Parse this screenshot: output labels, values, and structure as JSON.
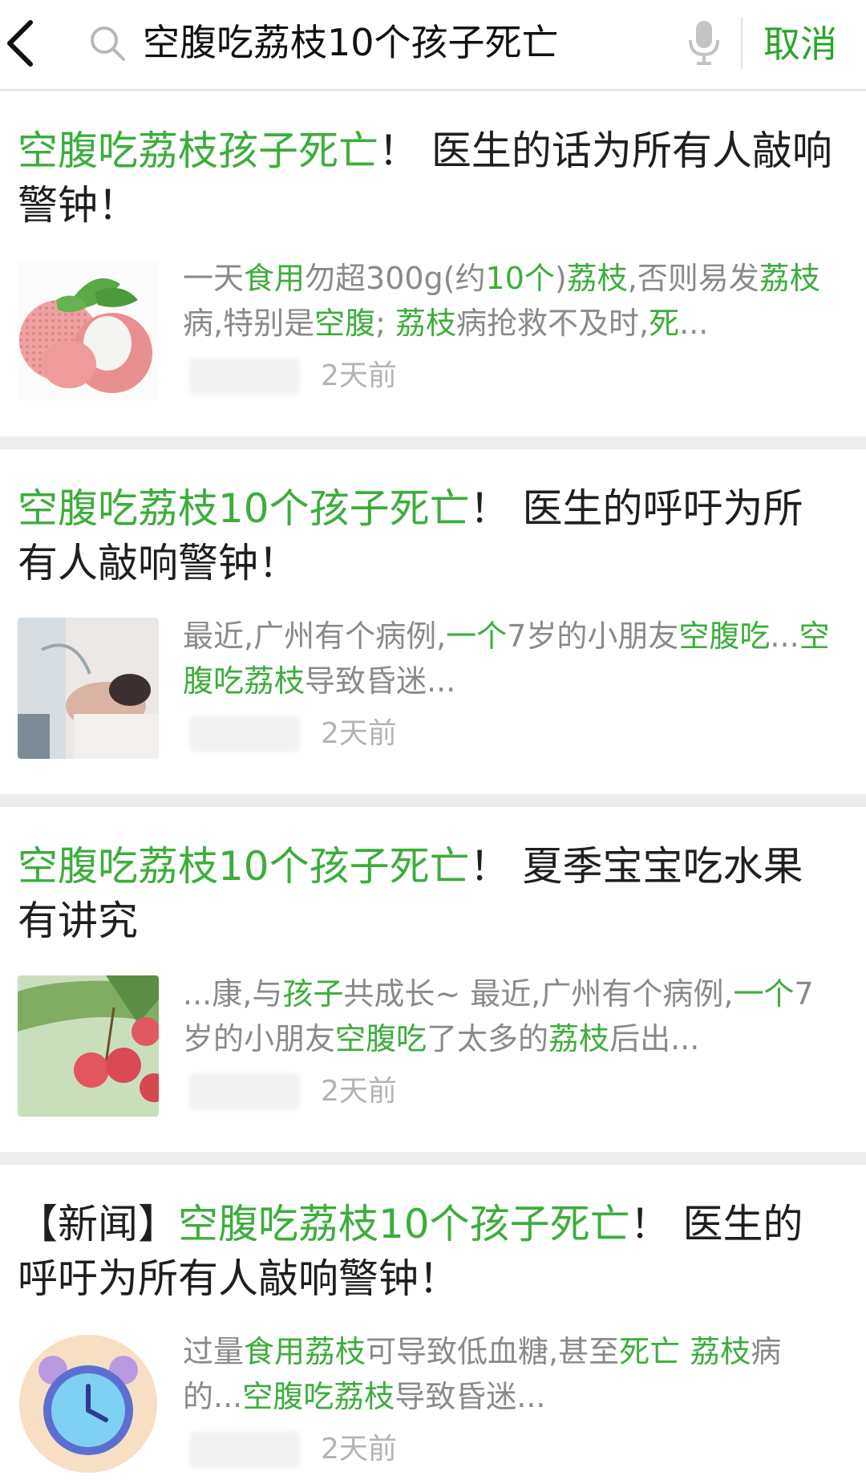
{
  "search": {
    "query": "空腹吃荔枝10个孩子死亡",
    "cancel_label": "取消"
  },
  "results": [
    {
      "title": [
        {
          "text": "空腹吃荔枝孩子死亡",
          "hl": true
        },
        {
          "text": "！ 医生的话为所有人敲响警钟！",
          "hl": false
        }
      ],
      "snippet": [
        {
          "text": "一天",
          "hl": false
        },
        {
          "text": "食用",
          "hl": true
        },
        {
          "text": "勿超300g(约",
          "hl": false
        },
        {
          "text": "10个",
          "hl": true
        },
        {
          "text": ")",
          "hl": false
        },
        {
          "text": "荔枝",
          "hl": true
        },
        {
          "text": ",否则易发",
          "hl": false
        },
        {
          "text": "荔枝",
          "hl": true
        },
        {
          "text": "病,特别是",
          "hl": false
        },
        {
          "text": "空腹",
          "hl": true
        },
        {
          "text": "; ",
          "hl": false
        },
        {
          "text": "荔枝",
          "hl": true
        },
        {
          "text": "病抢救不及时,",
          "hl": false
        },
        {
          "text": "死",
          "hl": true
        },
        {
          "text": "...",
          "hl": false
        }
      ],
      "time": "2天前",
      "thumb_icon": "lychee-image"
    },
    {
      "title": [
        {
          "text": "空腹吃荔枝10个孩子死亡",
          "hl": true
        },
        {
          "text": "！ 医生的呼吁为所有人敲响警钟！",
          "hl": false
        }
      ],
      "snippet": [
        {
          "text": "最近,广州有个病例,",
          "hl": false
        },
        {
          "text": "一个",
          "hl": true
        },
        {
          "text": "7岁的小朋友",
          "hl": false
        },
        {
          "text": "空腹",
          "hl": true
        },
        {
          "text": "吃",
          "hl": true
        },
        {
          "text": "...",
          "hl": false
        },
        {
          "text": "空腹吃荔枝",
          "hl": true
        },
        {
          "text": "导致昏迷...",
          "hl": false
        }
      ],
      "time": "2天前",
      "thumb_icon": "hospital-patient-image"
    },
    {
      "title": [
        {
          "text": "空腹吃荔枝10个孩子死亡",
          "hl": true
        },
        {
          "text": "！ 夏季宝宝吃水果有讲究",
          "hl": false
        }
      ],
      "snippet": [
        {
          "text": "...康,与",
          "hl": false
        },
        {
          "text": "孩子",
          "hl": true
        },
        {
          "text": "共成长~ 最近,广州有个病例,",
          "hl": false
        },
        {
          "text": "一个",
          "hl": true
        },
        {
          "text": "7岁的小朋友",
          "hl": false
        },
        {
          "text": "空腹吃",
          "hl": true
        },
        {
          "text": "了太多的",
          "hl": false
        },
        {
          "text": "荔枝",
          "hl": true
        },
        {
          "text": "后出...",
          "hl": false
        }
      ],
      "time": "2天前",
      "thumb_icon": "lychee-tree-image"
    },
    {
      "title": [
        {
          "text": "【新闻】",
          "hl": false
        },
        {
          "text": "空腹吃荔枝10个孩子死亡",
          "hl": true
        },
        {
          "text": "！ 医生的呼吁为所有人敲响警钟！",
          "hl": false
        }
      ],
      "snippet": [
        {
          "text": "过量",
          "hl": false
        },
        {
          "text": "食用荔枝",
          "hl": true
        },
        {
          "text": "可导致低血糖,甚至",
          "hl": false
        },
        {
          "text": "死亡 荔枝",
          "hl": true
        },
        {
          "text": "病的...",
          "hl": false
        },
        {
          "text": "空腹吃荔枝",
          "hl": true
        },
        {
          "text": "导致昏迷...",
          "hl": false
        }
      ],
      "time": "2天前",
      "thumb_icon": "alarm-clock-icon"
    }
  ],
  "colors": {
    "highlight": "#3cad3c",
    "cancel": "#2aa52a",
    "snippet": "#8a8a8a",
    "time": "#b4b4b4",
    "background": "#ededed"
  }
}
